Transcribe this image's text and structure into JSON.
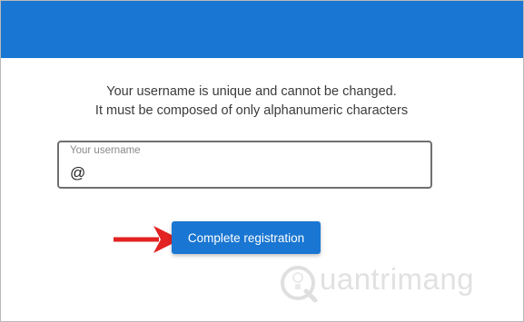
{
  "info": {
    "line1": "Your username is unique and cannot be changed.",
    "line2": "It must be composed of only alphanumeric characters"
  },
  "username_field": {
    "label": "Your username",
    "value": "@"
  },
  "actions": {
    "complete_label": "Complete registration"
  },
  "watermark": {
    "text": "uantrimang"
  },
  "colors": {
    "header": "#1976d2",
    "button": "#1976d2",
    "arrow": "#e32222"
  },
  "icons": {
    "arrow": "red-arrow-right-icon",
    "watermark_logo": "quantrimang-logo-icon"
  }
}
